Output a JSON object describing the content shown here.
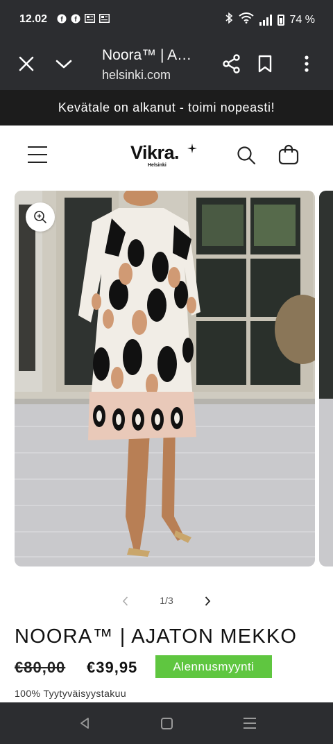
{
  "status_bar": {
    "time": "12.02",
    "notification_icons": [
      "facebook-icon",
      "facebook-icon",
      "news-icon",
      "news-icon"
    ],
    "battery": "74 %",
    "system_icons": [
      "bluetooth-icon",
      "wifi-icon",
      "signal-icon",
      "battery-icon"
    ]
  },
  "browser": {
    "tab_title": "Noora™ | A…",
    "url": "helsinki.com"
  },
  "announcement": "Kevätale on alkanut - toimi nopeasti!",
  "header": {
    "logo_text": "Vikra.",
    "logo_sub": "Helsinki"
  },
  "gallery": {
    "current": "1/3"
  },
  "product": {
    "title": "NOORA™ | AJATON MEKKO",
    "old_price": "€80,00",
    "price": "€39,95",
    "badge": "Alennusmyynti",
    "guarantee": "100% Tyytyväisyystakuu"
  },
  "colors": {
    "system_bar": "#2c2d30",
    "announcement_bg": "#1c1c1c",
    "sale_badge": "#5fc640"
  }
}
